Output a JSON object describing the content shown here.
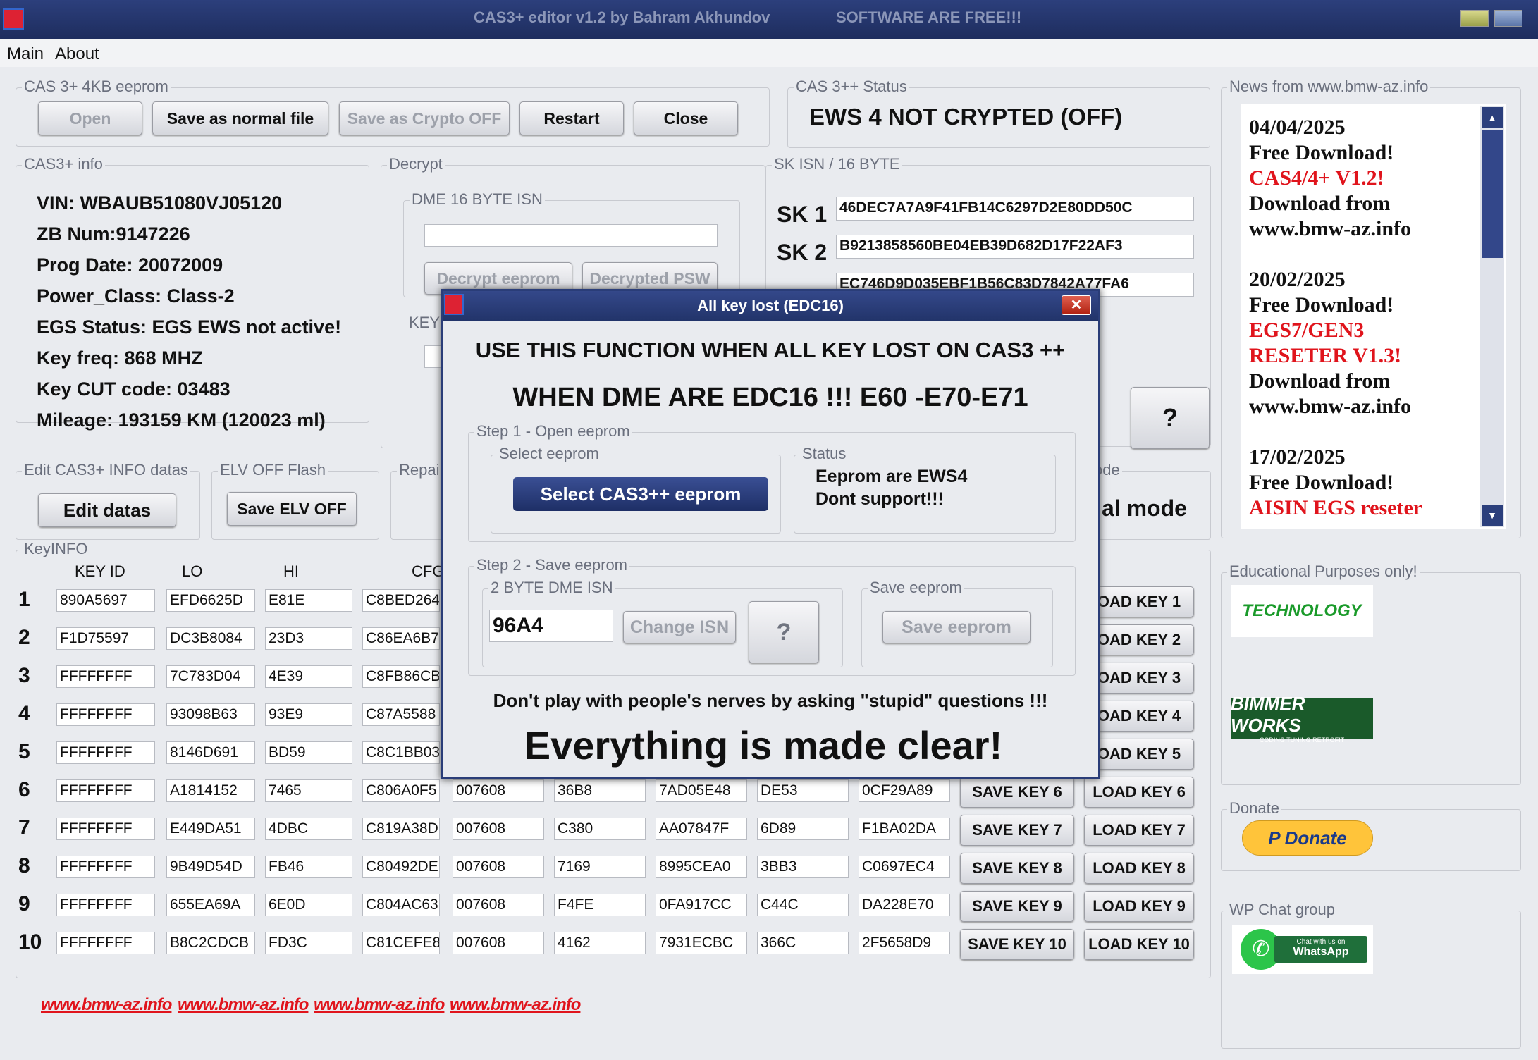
{
  "window": {
    "title": "CAS3+ editor v1.2 by Bahram Akhundov",
    "subtitle": "SOFTWARE ARE FREE!!!"
  },
  "menu": [
    "Main",
    "About"
  ],
  "eeprom_group": {
    "label": "CAS 3+ 4KB eeprom",
    "open": "Open",
    "save_normal": "Save as normal file",
    "save_crypto": "Save as Crypto OFF",
    "restart": "Restart",
    "close": "Close"
  },
  "status_group": {
    "label": "CAS 3++ Status",
    "value": "EWS 4 NOT CRYPTED (OFF)"
  },
  "info_group": {
    "label": "CAS3+ info",
    "lines": [
      "VIN: WBAUB51080VJ05120",
      "ZB Num:9147226",
      "Prog Date:  20072009",
      "Power_Class:  Class-2",
      "EGS Status:  EGS EWS not active!",
      "Key freq:  868 MHZ",
      "Key CUT code: 03483",
      "Mileage:  193159 KM (120023 ml)"
    ]
  },
  "decrypt_group": {
    "label": "Decrypt",
    "dme_label": "DME 16 BYTE ISN",
    "dme_value": "",
    "decrypt_btn": "Decrypt eeprom",
    "psw_btn": "Decrypted PSW",
    "key_label": "KEY"
  },
  "sk_group": {
    "label": "SK ISN / 16 BYTE",
    "rows": [
      {
        "label": "SK 1",
        "value": "46DEC7A7A9F41FB14C6297D2E80DD50C"
      },
      {
        "label": "SK 2",
        "value": "B9213858560BE04EB39D682D17F22AF3"
      },
      {
        "label": "SK 3",
        "value": "EC746D9D035EBF1B56C83D7842A77FA6"
      }
    ]
  },
  "help_btn": "?",
  "edit_group": {
    "label": "Edit CAS3+ INFO datas",
    "button": "Edit datas"
  },
  "elv_group": {
    "label": "ELV OFF Flash",
    "button": "Save ELV OFF"
  },
  "repair_group": {
    "label": "Repai"
  },
  "mode_group": {
    "label": "ode",
    "text": "al mode"
  },
  "keyinfo": {
    "label": "KeyINFO",
    "headers": [
      "KEY ID",
      "LO",
      "HI",
      "CFG"
    ],
    "rows": [
      {
        "n": "1",
        "id": "890A5697",
        "lo": "EFD6625D",
        "hi": "E81E",
        "cfg": "C8BED264",
        "c5": "",
        "c6": "",
        "c7": "",
        "c8": "",
        "c9": "",
        "save": "",
        "load": "OAD KEY 1"
      },
      {
        "n": "2",
        "id": "F1D75597",
        "lo": "DC3B8084",
        "hi": "23D3",
        "cfg": "C86EA6B7",
        "c5": "",
        "c6": "",
        "c7": "",
        "c8": "",
        "c9": "",
        "save": "",
        "load": "OAD KEY 2"
      },
      {
        "n": "3",
        "id": "FFFFFFFF",
        "lo": "7C783D04",
        "hi": "4E39",
        "cfg": "C8FB86CB",
        "c5": "",
        "c6": "",
        "c7": "",
        "c8": "",
        "c9": "",
        "save": "",
        "load": "OAD KEY 3"
      },
      {
        "n": "4",
        "id": "FFFFFFFF",
        "lo": "93098B63",
        "hi": "93E9",
        "cfg": "C87A5588",
        "c5": "",
        "c6": "",
        "c7": "",
        "c8": "",
        "c9": "",
        "save": "",
        "load": "OAD KEY 4"
      },
      {
        "n": "5",
        "id": "FFFFFFFF",
        "lo": "8146D691",
        "hi": "BD59",
        "cfg": "C8C1BB03",
        "c5": "",
        "c6": "",
        "c7": "",
        "c8": "",
        "c9": "",
        "save": "",
        "load": "OAD KEY 5"
      },
      {
        "n": "6",
        "id": "FFFFFFFF",
        "lo": "A1814152",
        "hi": "7465",
        "cfg": "C806A0F5",
        "c5": "007608",
        "c6": "36B8",
        "c7": "7AD05E48",
        "c8": "DE53",
        "c9": "0CF29A89",
        "save": "SAVE KEY 6",
        "load": "LOAD KEY 6"
      },
      {
        "n": "7",
        "id": "FFFFFFFF",
        "lo": "E449DA51",
        "hi": "4DBC",
        "cfg": "C819A38D",
        "c5": "007608",
        "c6": "C380",
        "c7": "AA07847F",
        "c8": "6D89",
        "c9": "F1BA02DA",
        "save": "SAVE KEY 7",
        "load": "LOAD KEY 7"
      },
      {
        "n": "8",
        "id": "FFFFFFFF",
        "lo": "9B49D54D",
        "hi": "FB46",
        "cfg": "C80492DE",
        "c5": "007608",
        "c6": "7169",
        "c7": "8995CEA0",
        "c8": "3BB3",
        "c9": "C0697EC4",
        "save": "SAVE KEY 8",
        "load": "LOAD KEY 8"
      },
      {
        "n": "9",
        "id": "FFFFFFFF",
        "lo": "655EA69A",
        "hi": "6E0D",
        "cfg": "C804AC63",
        "c5": "007608",
        "c6": "F4FE",
        "c7": "0FA917CC",
        "c8": "C44C",
        "c9": "DA228E70",
        "save": "SAVE KEY 9",
        "load": "LOAD KEY 9"
      },
      {
        "n": "10",
        "id": "FFFFFFFF",
        "lo": "B8C2CDCB",
        "hi": "FD3C",
        "cfg": "C81CEFE8",
        "c5": "007608",
        "c6": "4162",
        "c7": "7931ECBC",
        "c8": "366C",
        "c9": "2F5658D9",
        "save": "SAVE KEY 10",
        "load": "LOAD KEY 10"
      }
    ]
  },
  "urls": [
    "www.bmw-az.info",
    "www.bmw-az.info",
    "www.bmw-az.info",
    "www.bmw-az.info"
  ],
  "news": {
    "label": "News from www.bmw-az.info",
    "lines": [
      {
        "t": "04/04/2025",
        "red": false
      },
      {
        "t": "Free Download!",
        "red": false
      },
      {
        "t": "CAS4/4+ V1.2!",
        "red": true
      },
      {
        "t": "Download from",
        "red": false
      },
      {
        "t": "www.bmw-az.info",
        "red": false
      },
      {
        "t": "20/02/2025",
        "red": false
      },
      {
        "t": "Free Download!",
        "red": false
      },
      {
        "t": "EGS7/GEN3",
        "red": true
      },
      {
        "t": "RESETER V1.3!",
        "red": true
      },
      {
        "t": "Download from",
        "red": false
      },
      {
        "t": "www.bmw-az.info",
        "red": false
      },
      {
        "t": "17/02/2025",
        "red": false
      },
      {
        "t": "Free Download!",
        "red": false
      },
      {
        "t": "AISIN EGS reseter",
        "red": true
      }
    ]
  },
  "edu_group": {
    "label": "Educational Purposes only!",
    "logo1": "TECHNOLOGY",
    "logo2": "BIMMER WORKS",
    "logo2_sub": "CODING TUNING RETROFIT"
  },
  "donate_group": {
    "label": "Donate",
    "button": "Donate"
  },
  "wp_group": {
    "label": "WP Chat group",
    "line1": "Chat with us on",
    "line2": "WhatsApp"
  },
  "dialog": {
    "title": "All key lost (EDC16)",
    "heading1": "USE THIS FUNCTION WHEN ALL KEY LOST ON CAS3 ++",
    "heading2": "WHEN DME ARE EDC16 !!! E60 -E70-E71",
    "step1": "Step 1 - Open eeprom",
    "select_label": "Select eeprom",
    "select_btn": "Select CAS3++ eeprom",
    "status_label": "Status",
    "status_line1": "Eeprom are EWS4",
    "status_line2": "Dont support!!!",
    "step2": "Step 2 - Save eeprom",
    "isn_label": "2 BYTE DME ISN",
    "isn_value": "96A4",
    "change_btn": "Change ISN",
    "help": "?",
    "save_label": "Save eeprom",
    "save_btn": "Save eeprom",
    "warning": "Don't play with people's nerves by asking \"stupid\" questions !!!",
    "big": "Everything is made clear!"
  }
}
